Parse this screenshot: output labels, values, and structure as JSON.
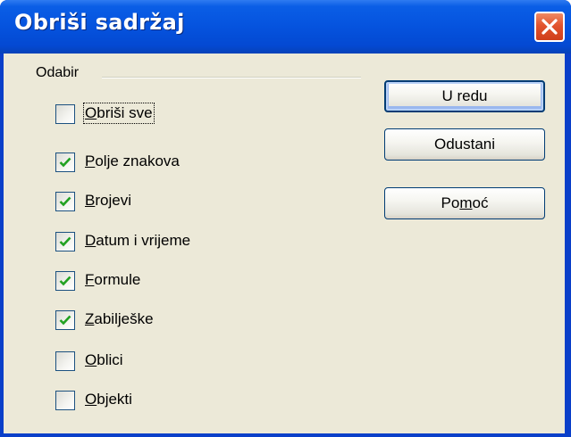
{
  "window": {
    "title": "Obriši sadržaj"
  },
  "group": {
    "label": "Odabir"
  },
  "checkboxes": [
    {
      "pre": "",
      "mnemonic": "O",
      "post": "briši sve",
      "checked": false
    },
    {
      "pre": "",
      "mnemonic": "P",
      "post": "olje znakova",
      "checked": true
    },
    {
      "pre": "",
      "mnemonic": "B",
      "post": "rojevi",
      "checked": true
    },
    {
      "pre": "",
      "mnemonic": "D",
      "post": "atum i vrijeme",
      "checked": true
    },
    {
      "pre": "",
      "mnemonic": "F",
      "post": "ormule",
      "checked": true
    },
    {
      "pre": "",
      "mnemonic": "Z",
      "post": "abilješke",
      "checked": true
    },
    {
      "pre": "",
      "mnemonic": "O",
      "post": "blici",
      "checked": false
    },
    {
      "pre": "",
      "mnemonic": "O",
      "post": "bjekti",
      "checked": false
    }
  ],
  "buttons": {
    "ok": "U redu",
    "cancel": "Odustani",
    "help_pre": "Po",
    "help_mnemonic": "m",
    "help_post": "oć"
  },
  "colors": {
    "titlebar": "#0553de",
    "dialog_bg": "#ece9d8",
    "check": "#21a121",
    "close": "#e2532d"
  }
}
